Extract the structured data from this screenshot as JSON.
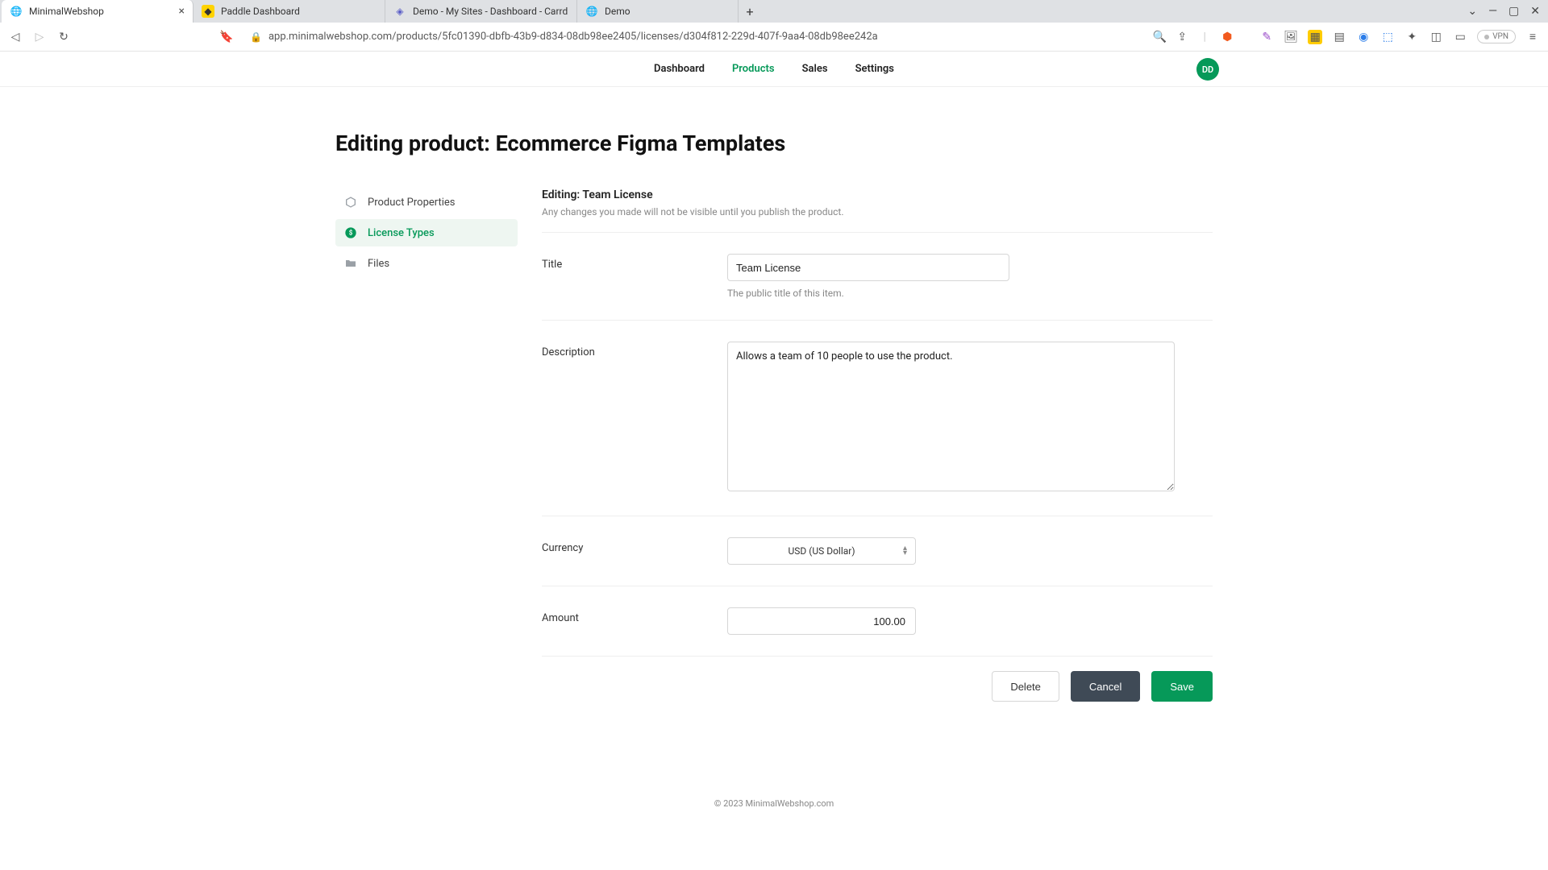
{
  "browser": {
    "tabs": [
      {
        "label": "MinimalWebshop",
        "active": true
      },
      {
        "label": "Paddle Dashboard",
        "active": false
      },
      {
        "label": "Demo - My Sites - Dashboard - Carrd",
        "active": false
      },
      {
        "label": "Demo",
        "active": false
      }
    ],
    "url": "app.minimalwebshop.com/products/5fc01390-dbfb-43b9-d834-08db98ee2405/licenses/d304f812-229d-407f-9aa4-08db98ee242a",
    "vpn_label": "VPN"
  },
  "nav": {
    "items": [
      "Dashboard",
      "Products",
      "Sales",
      "Settings"
    ],
    "active": "Products",
    "avatar": "DD"
  },
  "page": {
    "title": "Editing product: Ecommerce Figma Templates",
    "sidebar": [
      {
        "icon": "cube",
        "label": "Product Properties",
        "active": false
      },
      {
        "icon": "dollar",
        "label": "License Types",
        "active": true
      },
      {
        "icon": "folder",
        "label": "Files",
        "active": false
      }
    ],
    "section_title": "Editing: Team License",
    "section_sub": "Any changes you made will not be visible until you publish the product.",
    "fields": {
      "title": {
        "label": "Title",
        "value": "Team License",
        "hint": "The public title of this item."
      },
      "description": {
        "label": "Description",
        "value": "Allows a team of 10 people to use the product."
      },
      "currency": {
        "label": "Currency",
        "value": "USD (US Dollar)"
      },
      "amount": {
        "label": "Amount",
        "value": "100.00"
      }
    },
    "buttons": {
      "delete": "Delete",
      "cancel": "Cancel",
      "save": "Save"
    },
    "footer": "© 2023 MinimalWebshop.com"
  }
}
